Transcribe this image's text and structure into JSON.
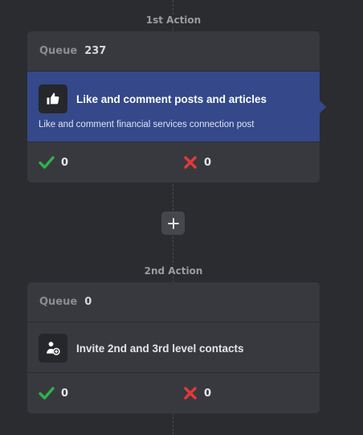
{
  "actions": [
    {
      "heading": "1st Action",
      "queue_label": "Queue",
      "queue_value": "237",
      "task_title": "Like and comment posts and articles",
      "task_description": "Like and comment financial services connection post",
      "icon": "thumbs-up-icon",
      "success_count": "0",
      "fail_count": "0",
      "selected": true
    },
    {
      "heading": "2nd Action",
      "queue_label": "Queue",
      "queue_value": "0",
      "task_title": "Invite 2nd and 3rd level contacts",
      "icon": "add-user-icon",
      "success_count": "0",
      "fail_count": "0",
      "selected": false
    }
  ],
  "add_action_icon": "plus-icon",
  "colors": {
    "background": "#2b2c30",
    "card": "#38393e",
    "selected": "#34488a",
    "success": "#2fb24a",
    "fail": "#e5393a"
  }
}
